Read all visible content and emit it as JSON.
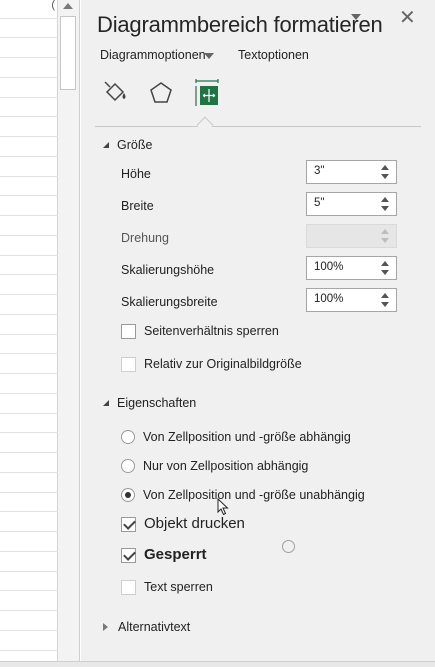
{
  "sheet": {
    "paren_glyph": "("
  },
  "pane": {
    "title": "Diagrammbereich formatieren",
    "close_glyph": "✕",
    "tabs": [
      {
        "label": "Diagrammoptionen"
      },
      {
        "label": "Textoptionen"
      }
    ],
    "icons": [
      "fill-line-icon",
      "effects-pentagon-icon",
      "size-properties-icon"
    ],
    "accent_color": "#217346"
  },
  "size_section": {
    "heading": "Größe",
    "rows": [
      {
        "label": "Höhe",
        "value": "3\""
      },
      {
        "label": "Breite",
        "value": "5\""
      },
      {
        "label": "Drehung",
        "value": ""
      },
      {
        "label": "Skalierungshöhe",
        "value": "100%"
      },
      {
        "label": "Skalierungsbreite",
        "value": "100%"
      }
    ],
    "checkboxes": [
      {
        "label": "Seitenverhältnis sperren",
        "checked": false
      },
      {
        "label": "Relativ zur Originalbildgröße",
        "checked": false
      }
    ]
  },
  "properties_section": {
    "heading": "Eigenschaften",
    "radios": [
      {
        "label": "Von Zellposition und -größe abhängig",
        "checked": false
      },
      {
        "label": "Nur von Zellposition abhängig",
        "checked": false
      },
      {
        "label": "Von Zellposition und -größe unabhängig",
        "checked": true
      }
    ],
    "checkboxes": [
      {
        "label": "Objekt drucken",
        "checked": true
      },
      {
        "label": "Gesperrt",
        "checked": true
      },
      {
        "label": "Text sperren",
        "checked": false
      }
    ]
  },
  "alt_text_section": {
    "heading": "Alternativtext"
  }
}
